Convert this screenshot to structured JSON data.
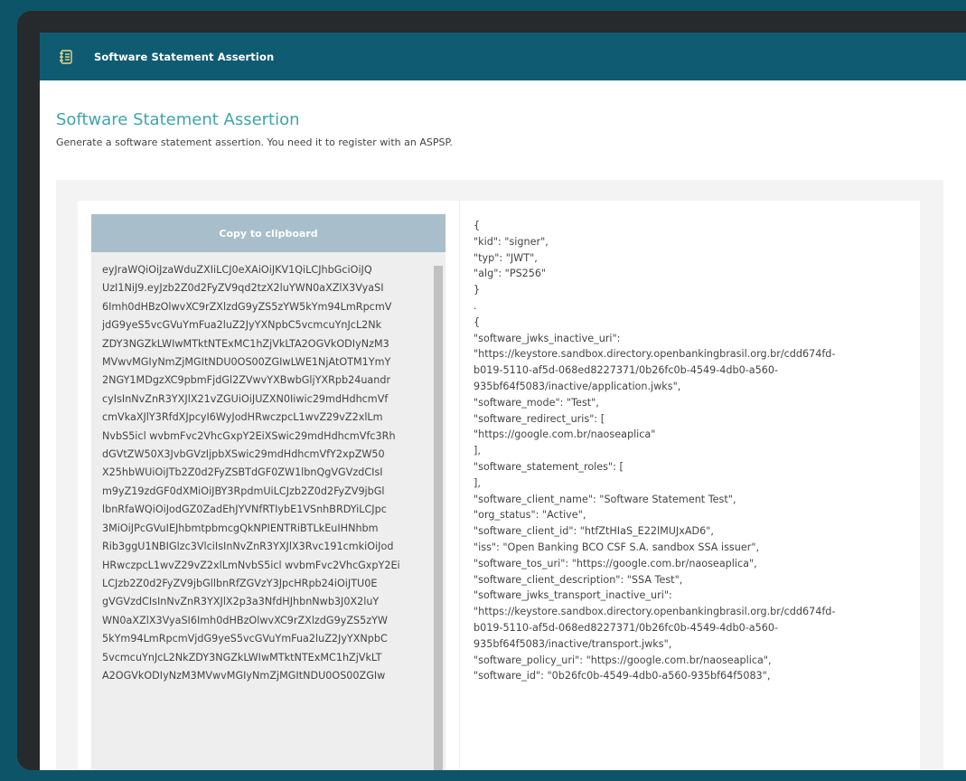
{
  "header": {
    "title": "Software Statement Assertion",
    "icon": "document-stack-icon",
    "chevron": "chevron-down-icon"
  },
  "main": {
    "title": "Software Statement Assertion",
    "subtitle": "Generate a software statement assertion. You need it to register with an ASPSP.",
    "copy_button_label": "Copy to clipboard",
    "token_lines": [
      "eyJraWQiOiJzaWduZXIiLCJ0eXAiOiJKV1QiLCJhbGciOiJQ",
      "UzI1NiJ9.eyJzb2Z0d2FyZV9qd2tzX2luYWN0aXZlX3VyaSI",
      "6Imh0dHBzOlwvXC9rZXlzdG9yZS5zYW5kYm94LmRpcmV",
      "jdG9yeS5vcGVuYmFua2luZ2JyYXNpbC5vcmcuYnJcL2Nk",
      "ZDY3NGZkLWIwMTktNTExMC1hZjVkLTA2OGVkODIyNzM3",
      "MVwvMGIyNmZjMGItNDU0OS00ZGIwLWE1NjAtOTM1YmY",
      "2NGY1MDgzXC9pbmFjdGl2ZVwvYXBwbGljYXRpb24uandr",
      "cyIsInNvZnR3YXJlX21vZGUiOiJUZXN0Iiwic29mdHdhcmVf",
      "cmVkaXJlY3RfdXJpcyI6WyJodHRwczpcL1wvZ29vZ2xlLm",
      "NvbS5icl wvbmFvc2VhcGxpY2EiXSwic29mdHdhcmVfc3Rh",
      "dGVtZW50X3JvbGVzIjpbXSwic29mdHdhcmVfY2xpZW50",
      "X25hbWUiOiJTb2Z0d2FyZSBTdGF0ZW1lbnQgVGVzdCIsI",
      "m9yZ19zdGF0dXMiOiJBY3RpdmUiLCJzb2Z0d2FyZV9jbGl",
      "lbnRfaWQiOiJodGZ0ZadEhJYVNfRTIybE1VSnhBRDYiLCJpc",
      "3MiOiJPcGVuIEJhbmtpbmcgQkNPIENTRiBTLkEuIHNhbm",
      "Rib3ggU1NBIGlzc3VlciIsInNvZnR3YXJlX3Rvc191cmkiOiJod",
      "HRwczpcL1wvZ29vZ2xlLmNvbS5icl wvbmFvc2VhcGxpY2Ei",
      "LCJzb2Z0d2FyZV9jbGllbnRfZGVzY3JpcHRpb24iOiJTU0E",
      "gVGVzdCIsInNvZnR3YXJlX2p3a3NfdHJhbnNwb3J0X2luY",
      "WN0aXZlX3VyaSI6Imh0dHBzOlwvXC9rZXlzdG9yZS5zYW",
      "5kYm94LmRpcmVjdG9yeS5vcGVuYmFua2luZ2JyYXNpbC",
      "5vcmcuYnJcL2NkZDY3NGZkLWIwMTktNTExMC1hZjVkLT",
      "A2OGVkODIyNzM3MVwvMGIyNmZjMGItNDU0OS00ZGIw"
    ],
    "json_lines": [
      "{",
      "\"kid\": \"signer\",",
      "\"typ\": \"JWT\",",
      "\"alg\": \"PS256\"",
      "}",
      ".",
      "{",
      "\"software_jwks_inactive_uri\":",
      "\"https://keystore.sandbox.directory.openbankingbrasil.org.br/cdd674fd-",
      "b019-5110-af5d-068ed8227371/0b26fc0b-4549-4db0-a560-",
      "935bf64f5083/inactive/application.jwks\",",
      "\"software_mode\": \"Test\",",
      "\"software_redirect_uris\": [",
      "\"https://google.com.br/naoseaplica\"",
      "],",
      "\"software_statement_roles\": [",
      "],",
      "\"software_client_name\": \"Software Statement Test\",",
      "\"org_status\": \"Active\",",
      "\"software_client_id\": \"htfZtHIaS_E22lMUJxAD6\",",
      "\"iss\": \"Open Banking BCO CSF S.A. sandbox SSA issuer\",",
      "\"software_tos_uri\": \"https://google.com.br/naoseaplica\",",
      "\"software_client_description\": \"SSA Test\",",
      "\"software_jwks_transport_inactive_uri\":",
      "\"https://keystore.sandbox.directory.openbankingbrasil.org.br/cdd674fd-",
      "b019-5110-af5d-068ed8227371/0b26fc0b-4549-4db0-a560-",
      "935bf64f5083/inactive/transport.jwks\",",
      "\"software_policy_uri\": \"https://google.com.br/naoseaplica\",",
      "\"software_id\": \"0b26fc0b-4549-4db0-a560-935bf64f5083\","
    ]
  },
  "colors": {
    "page_bg": "#0e5468",
    "frame_bg": "#262a2c",
    "header_bg": "#0f5b72",
    "title_accent": "#3fa5a8",
    "copy_button_bg": "#a8bfcb"
  }
}
